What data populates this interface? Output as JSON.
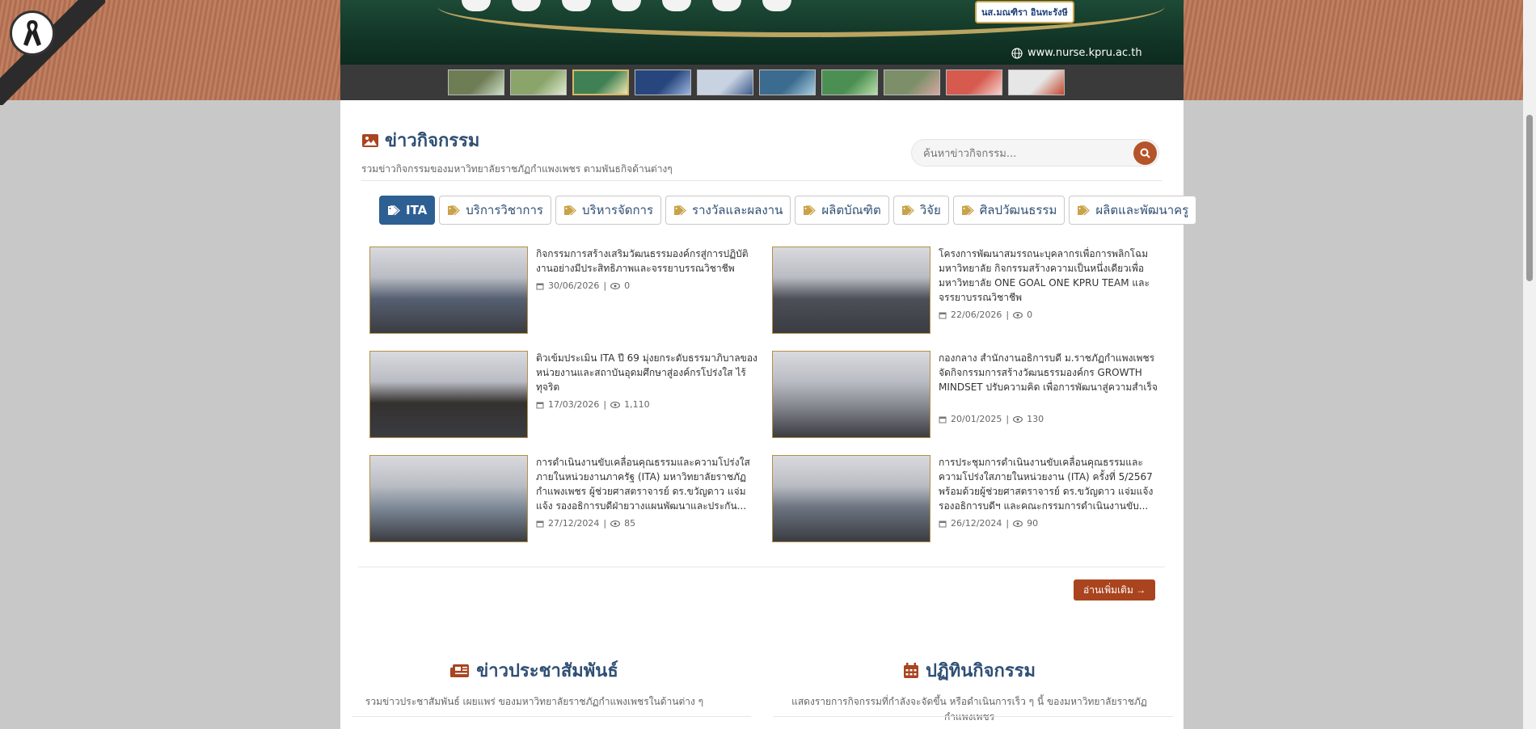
{
  "header": {
    "name_badge": "นส.มณฑิรา อินทะรังษี",
    "url": "www.nurse.kpru.ac.th",
    "thumbnails": [
      {
        "color": "#6f7d55",
        "accent": "#cde0c8"
      },
      {
        "color": "#8aa46a",
        "accent": "#e0ebd2"
      },
      {
        "color": "#3f8054",
        "accent": "#efe7b0"
      },
      {
        "color": "#27467d",
        "accent": "#9db7e2"
      },
      {
        "color": "#c8d3e2",
        "accent": "#3e5b8d"
      },
      {
        "color": "#3b6b8e",
        "accent": "#a9cfe0"
      },
      {
        "color": "#4c8f52",
        "accent": "#b9dfa9"
      },
      {
        "color": "#7d8f69",
        "accent": "#d7a7a2"
      },
      {
        "color": "#d65a4e",
        "accent": "#f6d3cf"
      },
      {
        "color": "#e6e6e6",
        "accent": "#c4482e"
      }
    ]
  },
  "activities": {
    "title": "ข่าวกิจกรรม",
    "subtitle": "รวมข่าวกิจกรรมของมหาวิทยาลัยราชภัฏกำแพงเพชร ตามพันธกิจด้านต่างๆ",
    "search_placeholder": "ค้นหาข่าวกิจกรรม...",
    "tags": [
      "ITA",
      "บริการวิชาการ",
      "บริหารจัดการ",
      "รางวัลและผลงาน",
      "ผลิตบัณฑิต",
      "วิจัย",
      "ศิลปวัฒนธรรม",
      "ผลิตและพัฒนาครู"
    ],
    "items": [
      {
        "title": "กิจกรรมการสร้างเสริมวัฒนธรรมองค์กรสู่การปฏิบัติงานอย่างมีประสิทธิภาพและจรรยาบรรณวิชาชีพ",
        "date": "30/06/2026",
        "views": "0",
        "img": "#566072"
      },
      {
        "title": "โครงการพัฒนาสมรรถนะบุคลากรเพื่อการพลิกโฉมมหาวิทยาลัย กิจกรรมสร้างความเป็นหนึ่งเดียวเพื่อมหาวิทยาลัย ONE GOAL ONE KPRU TEAM และจรรยาบรรณวิชาชีพ",
        "date": "22/06/2026",
        "views": "0",
        "img": "#4c4f57"
      },
      {
        "title": "ติวเข้มประเมิน ITA ปี 69 มุ่งยกระดับธรรมาภิบาลของหน่วยงานและสถาบันอุดมศึกษาสู่องค์กรโปร่งใส ไร้ทุจริต",
        "date": "17/03/2026",
        "views": "1,110",
        "img": "#34312f"
      },
      {
        "title": "กองกลาง สำนักงานอธิการบดี ม.ราชภัฏกำแพงเพชร จัดกิจกรรมการสร้างวัฒนธรรมองค์กร GROWTH MINDSET ปรับความคิด เพื่อการพัฒนาสู่ความสำเร็จ",
        "date": "20/01/2025",
        "views": "130",
        "img": "#8c8f96"
      },
      {
        "title": "การดำเนินงานขับเคลื่อนคุณธรรมและความโปร่งใสภายในหน่วยงานภาครัฐ (ITA) มหาวิทยาลัยราชภัฏกำแพงเพชร ผู้ช่วยศาสตราจารย์ ดร.ขวัญดาว แจ่มแจ้ง รองอธิการบดีฝ่ายวางแผนพัฒนาและประกัน...",
        "date": "27/12/2024",
        "views": "85",
        "img": "#7e8a98"
      },
      {
        "title": "การประชุมการดำเนินงานขับเคลื่อนคุณธรรมและความโปร่งใสภายในหน่วยงาน (ITA) ครั้งที่ 5/2567 พร้อมด้วยผู้ช่วยศาสตราจารย์ ดร.ขวัญดาว แจ่มแจ้ง รองอธิการบดีฯ และคณะกรรมการดำเนินงานขับ...",
        "date": "26/12/2024",
        "views": "90",
        "img": "#6d7480"
      }
    ],
    "more_label": "อ่านเพิ่มเติม →"
  },
  "press": {
    "title": "ข่าวประชาสัมพันธ์",
    "subtitle": "รวมข่าวประชาสัมพันธ์ เผยแพร่ ของมหาวิทยาลัยราชภัฏกำแพงเพชรในด้านต่าง ๆ"
  },
  "calendar": {
    "title": "ปฏิทินกิจกรรม",
    "subtitle": "แสดงรายการกิจกรรมที่กำลังจะจัดขึ้น หรือดำเนินการเร็ว ๆ นี้ ของมหาวิทยาลัยราชภัฏกำแพงเพชร"
  },
  "colors": {
    "accent": "#b5532a",
    "tag_active": "#2d5f93",
    "heading": "#2f4f74"
  }
}
